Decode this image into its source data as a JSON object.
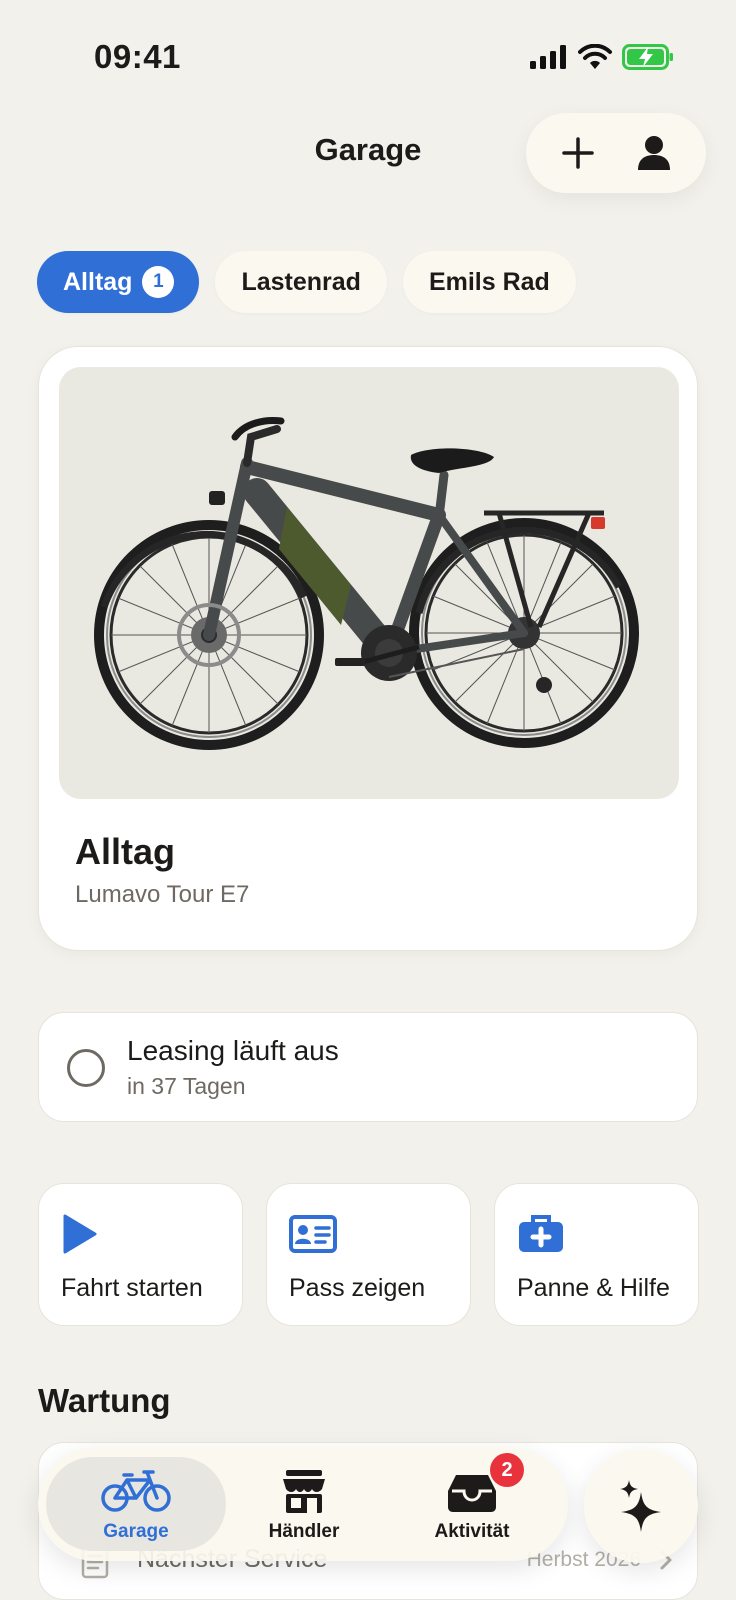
{
  "status_bar": {
    "time": "09:41"
  },
  "header": {
    "title": "Garage",
    "add_icon": "plus-icon",
    "profile_icon": "person-icon"
  },
  "chips": [
    {
      "label": "Alltag",
      "badge": "1",
      "active": true
    },
    {
      "label": "Lastenrad"
    },
    {
      "label": "Emils Rad"
    }
  ],
  "bike": {
    "name": "Alltag",
    "model": "Lumavo Tour E7"
  },
  "leasing": {
    "title": "Leasing läuft aus",
    "subtitle": "in 37 Tagen"
  },
  "quick_actions": [
    {
      "label": "Fahrt starten",
      "icon": "play-icon"
    },
    {
      "label": "Pass zeigen",
      "icon": "id-card-icon"
    },
    {
      "label": "Panne & Hilfe",
      "icon": "first-aid-kit-icon"
    }
  ],
  "maintenance": {
    "title": "Wartung",
    "rows": [
      {
        "label": "Nächster Service",
        "value": "Herbst 2026"
      }
    ]
  },
  "tab_bar": {
    "tabs": [
      {
        "label": "Garage",
        "icon": "bicycle-icon",
        "active": true
      },
      {
        "label": "Händler",
        "icon": "store-icon"
      },
      {
        "label": "Aktivität",
        "icon": "inbox-icon",
        "badge": "2"
      }
    ],
    "ai_icon": "sparkles-icon"
  },
  "colors": {
    "accent": "#2f6fd6",
    "background": "#f2f1ec",
    "badge": "#e8323c"
  }
}
